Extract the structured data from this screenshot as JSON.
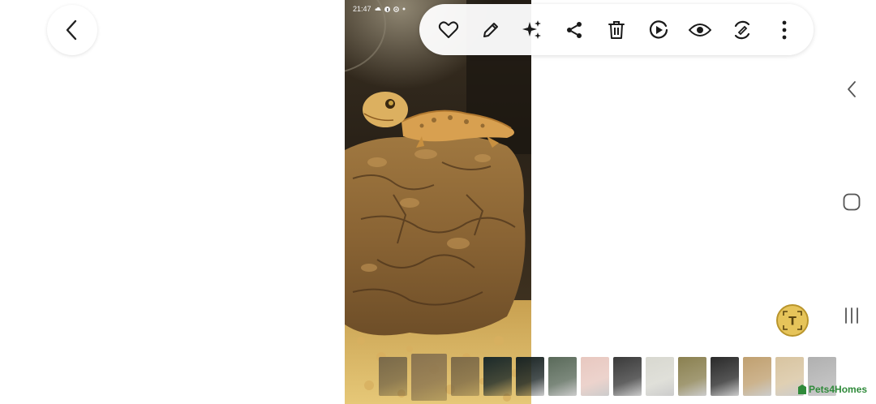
{
  "status_bar": {
    "time": "21:47",
    "icons": [
      "cloud-icon",
      "facebook-icon",
      "settings-icon",
      "dot-icon"
    ]
  },
  "toolbar": {
    "buttons": [
      "heart-icon",
      "edit-icon",
      "sparkle-icon",
      "share-icon",
      "delete-icon",
      "play-icon",
      "eye-icon",
      "remaster-icon",
      "more-icon"
    ]
  },
  "navigation": {
    "back": "chevron-left-icon",
    "recent_apps": "three-lines-icon",
    "home": "rounded-square-icon",
    "nav_back": "chevron-left-icon"
  },
  "text_extract_button": {
    "icon_letter": "T",
    "color": "#e6c45a"
  },
  "filmstrip": {
    "selected_index": 1,
    "thumbnails": [
      {
        "color": "#7a6a4a"
      },
      {
        "color": "#8a7450"
      },
      {
        "color": "#7e6b48"
      },
      {
        "color": "#1c2a2a"
      },
      {
        "color": "#1a2424"
      },
      {
        "color": "#5a6a5a"
      },
      {
        "color": "#e8c8c0"
      },
      {
        "color": "#3a3a3a"
      },
      {
        "color": "#d8d8d0"
      },
      {
        "color": "#8a8050"
      },
      {
        "color": "#2a2a2a"
      },
      {
        "color": "#c0a070"
      },
      {
        "color": "#d8c4a0"
      },
      {
        "color": "#b0b0b0"
      }
    ]
  },
  "watermark": {
    "text": "Pets4Homes",
    "color": "#2f8a3a"
  },
  "photo": {
    "subject": "leopard gecko on cork bark"
  }
}
